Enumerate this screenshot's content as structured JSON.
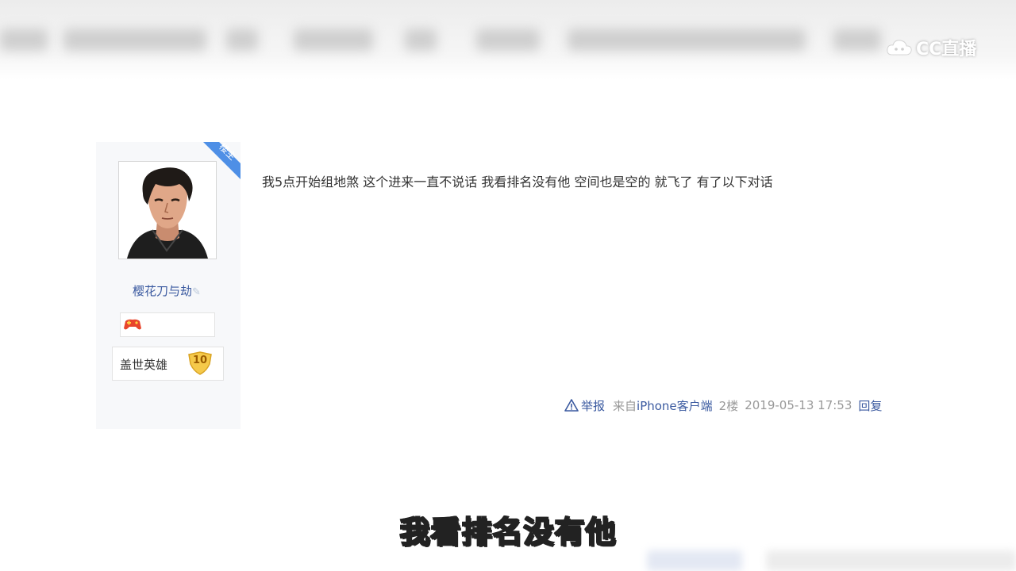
{
  "watermark": {
    "logo_text": "CC直播"
  },
  "post": {
    "author": {
      "username": "樱花刀与劫",
      "role_ribbon": "楼主",
      "level_title": "盖世英雄",
      "level_number": "10"
    },
    "content": "我5点开始组地煞 这个进来一直不说话 我看排名没有他 空间也是空的 就飞了 有了以下对话",
    "footer": {
      "report_label": "举报",
      "source": "来自iPhone客户端",
      "floor": "2楼",
      "timestamp": "2019-05-13 17:53",
      "reply_label": "回复"
    }
  },
  "subtitle": "我看排名没有他",
  "colors": {
    "link_blue": "#3b5aa0",
    "ribbon_blue": "#4e8fe6",
    "sidebar_bg": "#f7f8fa",
    "meta_gray": "#999999"
  }
}
